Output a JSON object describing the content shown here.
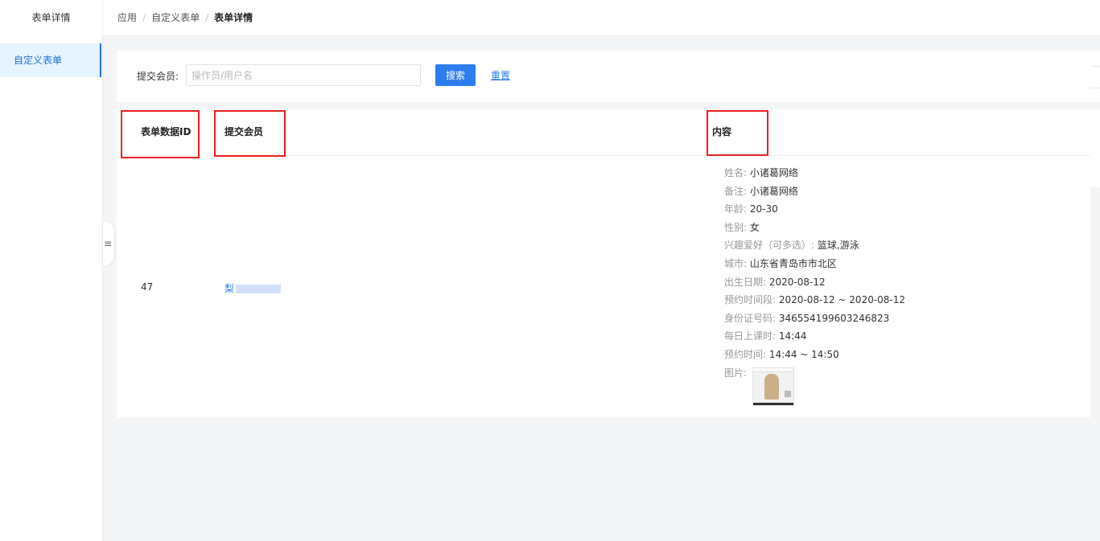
{
  "header": {
    "app_title": "表单详情",
    "breadcrumb": [
      "应用",
      "自定义表单",
      "表单详情"
    ],
    "separator": "/"
  },
  "sidebar": {
    "items": [
      {
        "label": "自定义表单",
        "active": true
      }
    ],
    "collapse_icon": "≡"
  },
  "search": {
    "label": "提交会员:",
    "placeholder": "操作员/用户名",
    "value": "",
    "search_button": "搜索",
    "reset_link": "重置"
  },
  "table": {
    "columns": [
      "表单数据ID",
      "提交会员",
      "内容"
    ],
    "rows": [
      {
        "id": "47",
        "member": "梨",
        "content": [
          {
            "key": "姓名:",
            "value": "小诸葛网络"
          },
          {
            "key": "备注:",
            "value": "小诸葛网络"
          },
          {
            "key": "年龄:",
            "value": "20-30"
          },
          {
            "key": "性别:",
            "value": "女"
          },
          {
            "key": "兴趣爱好（可多选）:",
            "value": "篮球,游泳"
          },
          {
            "key": "城市:",
            "value": "山东省青岛市市北区"
          },
          {
            "key": "出生日期:",
            "value": "2020-08-12"
          },
          {
            "key": "预约时间段:",
            "value": "2020-08-12 ~ 2020-08-12"
          },
          {
            "key": "身份证号码:",
            "value": "346554199603246823"
          },
          {
            "key": "每日上课时:",
            "value": "14:44"
          },
          {
            "key": "预约时间:",
            "value": "14:44 ~ 14:50"
          },
          {
            "key": "图片:",
            "value": ""
          }
        ]
      }
    ]
  },
  "colors": {
    "accent": "#2d7cf0",
    "highlight_box": "#e8201f",
    "sidebar_active_bg": "#e6f4ff",
    "page_bg": "#f4f5f7"
  }
}
